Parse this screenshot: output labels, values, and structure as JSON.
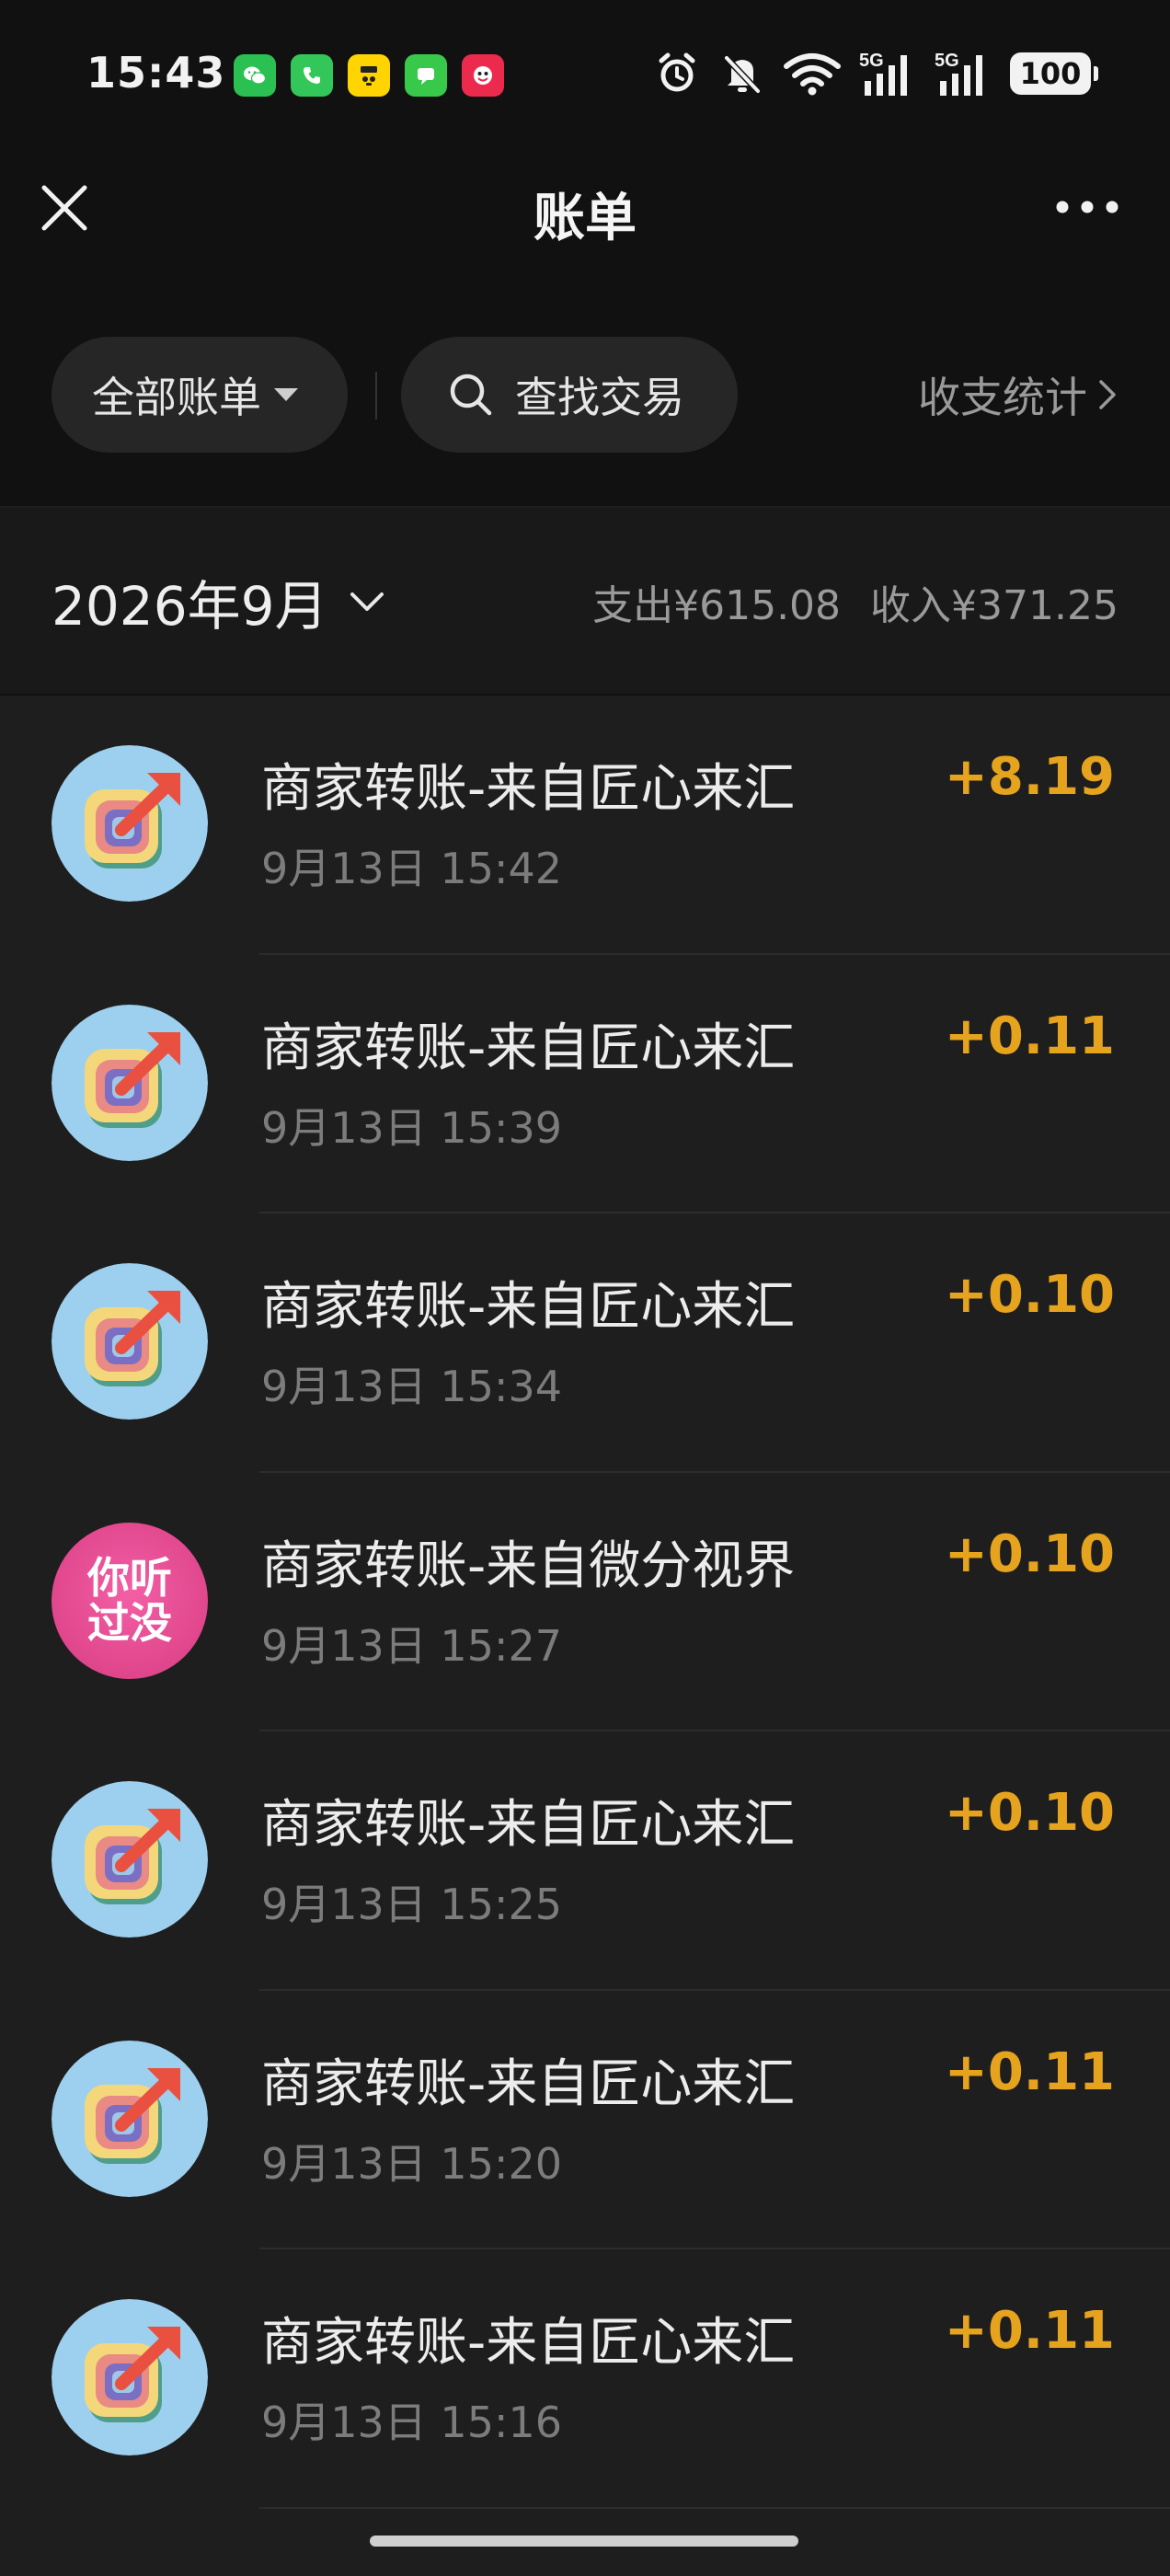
{
  "status_bar": {
    "time": "15:43",
    "battery": "100",
    "notification_icons": [
      "wechat-icon",
      "phone-icon",
      "yellow-app-icon",
      "messages-icon",
      "red-app-icon"
    ],
    "system_icons": [
      "alarm-icon",
      "mute-bell-icon",
      "wifi-icon",
      "signal-5g-icon",
      "signal-5g-icon"
    ],
    "signal_label": "5G"
  },
  "header": {
    "title": "账单",
    "close_icon": "close-icon",
    "more_icon": "more-icon"
  },
  "filters": {
    "all_bills": "全部账单",
    "search": "查找交易",
    "stats": "收支统计"
  },
  "month": {
    "label": "2026年9月",
    "expense": "支出¥615.08",
    "income": "收入¥371.25"
  },
  "transactions": [
    {
      "name": "商家转账-来自匠心来汇",
      "time": "9月13日 15:42",
      "amount": "+8.19",
      "avatar": "craft-logo"
    },
    {
      "name": "商家转账-来自匠心来汇",
      "time": "9月13日 15:39",
      "amount": "+0.11",
      "avatar": "craft-logo"
    },
    {
      "name": "商家转账-来自匠心来汇",
      "time": "9月13日 15:34",
      "amount": "+0.10",
      "avatar": "craft-logo"
    },
    {
      "name": "商家转账-来自微分视界",
      "time": "9月13日 15:27",
      "amount": "+0.10",
      "avatar": "text-logo",
      "avatar_text": [
        "你听",
        "过没"
      ]
    },
    {
      "name": "商家转账-来自匠心来汇",
      "time": "9月13日 15:25",
      "amount": "+0.10",
      "avatar": "craft-logo"
    },
    {
      "name": "商家转账-来自匠心来汇",
      "time": "9月13日 15:20",
      "amount": "+0.11",
      "avatar": "craft-logo"
    },
    {
      "name": "商家转账-来自匠心来汇",
      "time": "9月13日 15:16",
      "amount": "+0.11",
      "avatar": "craft-logo"
    }
  ],
  "colors": {
    "background": "#111111",
    "list_background": "#1e1e1e",
    "income_amount": "#e6a31e",
    "secondary_text": "#9a9a9a"
  }
}
